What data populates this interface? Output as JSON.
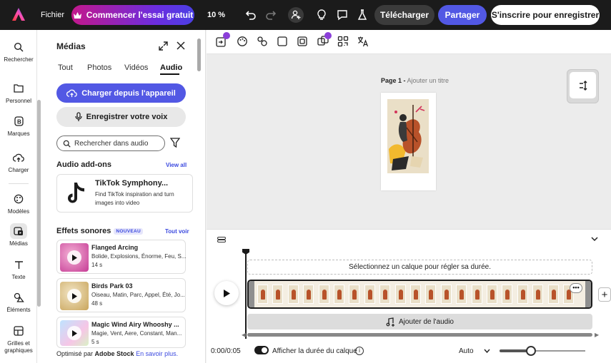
{
  "topbar": {
    "file_label": "Fichier",
    "trial_label": "Commencer l'essai gratuit",
    "zoom": "10 %",
    "download_label": "Télécharger",
    "share_label": "Partager",
    "signup_label": "S'inscrire pour enregistrer"
  },
  "nav": {
    "search": "Rechercher",
    "personal": "Personnel",
    "brands": "Marques",
    "upload": "Charger",
    "templates": "Modèles",
    "media": "Médias",
    "text": "Texte",
    "elements": "Éléments",
    "grids_line1": "Grilles et",
    "grids_line2": "graphiques"
  },
  "panel": {
    "title": "Médias",
    "tabs": [
      "Tout",
      "Photos",
      "Vidéos",
      "Audio"
    ],
    "active_tab": "Audio",
    "upload_label": "Charger depuis l'appareil",
    "record_label": "Enregistrer votre voix",
    "search_placeholder": "Rechercher dans audio",
    "addons_title": "Audio add-ons",
    "addons_link": "View all",
    "addon": {
      "name": "TikTok Symphony...",
      "desc_line1": "Find TikTok inspiration and turn",
      "desc_line2": "images into video"
    },
    "effects_title": "Effets sonores",
    "effects_badge": "NOUVEAU",
    "effects_link": "Tout voir",
    "sounds": [
      {
        "name": "Flanged Arcing",
        "tags": "Bolide, Explosions, Énorme, Feu, S...",
        "duration": "14 s"
      },
      {
        "name": "Birds Park 03",
        "tags": "Oiseau, Matin, Parc, Appel, Été, Jo...",
        "duration": "48 s"
      },
      {
        "name": "Magic Wind Airy Whooshy ...",
        "tags": "Magie, Vent, Aere, Constant, Man...",
        "duration": "5 s"
      }
    ],
    "powered_prefix": "Optimisé par ",
    "powered_brand": "Adobe Stock",
    "powered_link": "En savoir plus."
  },
  "canvas": {
    "page_number": "Page 1 -",
    "page_title_placeholder": "Ajouter un titre"
  },
  "timeline": {
    "hint": "Sélectionnez un calque pour régler sa durée.",
    "clip_menu": "•••",
    "add_audio_label": "Ajouter de l'audio",
    "time": "0:00/0:05",
    "show_duration_label": "Afficher la durée du calque",
    "speed": "Auto",
    "frame_count": 21,
    "zoom_level": 0.37
  },
  "colors": {
    "accent": "#5258e4",
    "topbar": "#1b1b1b",
    "link": "#3b49df"
  }
}
